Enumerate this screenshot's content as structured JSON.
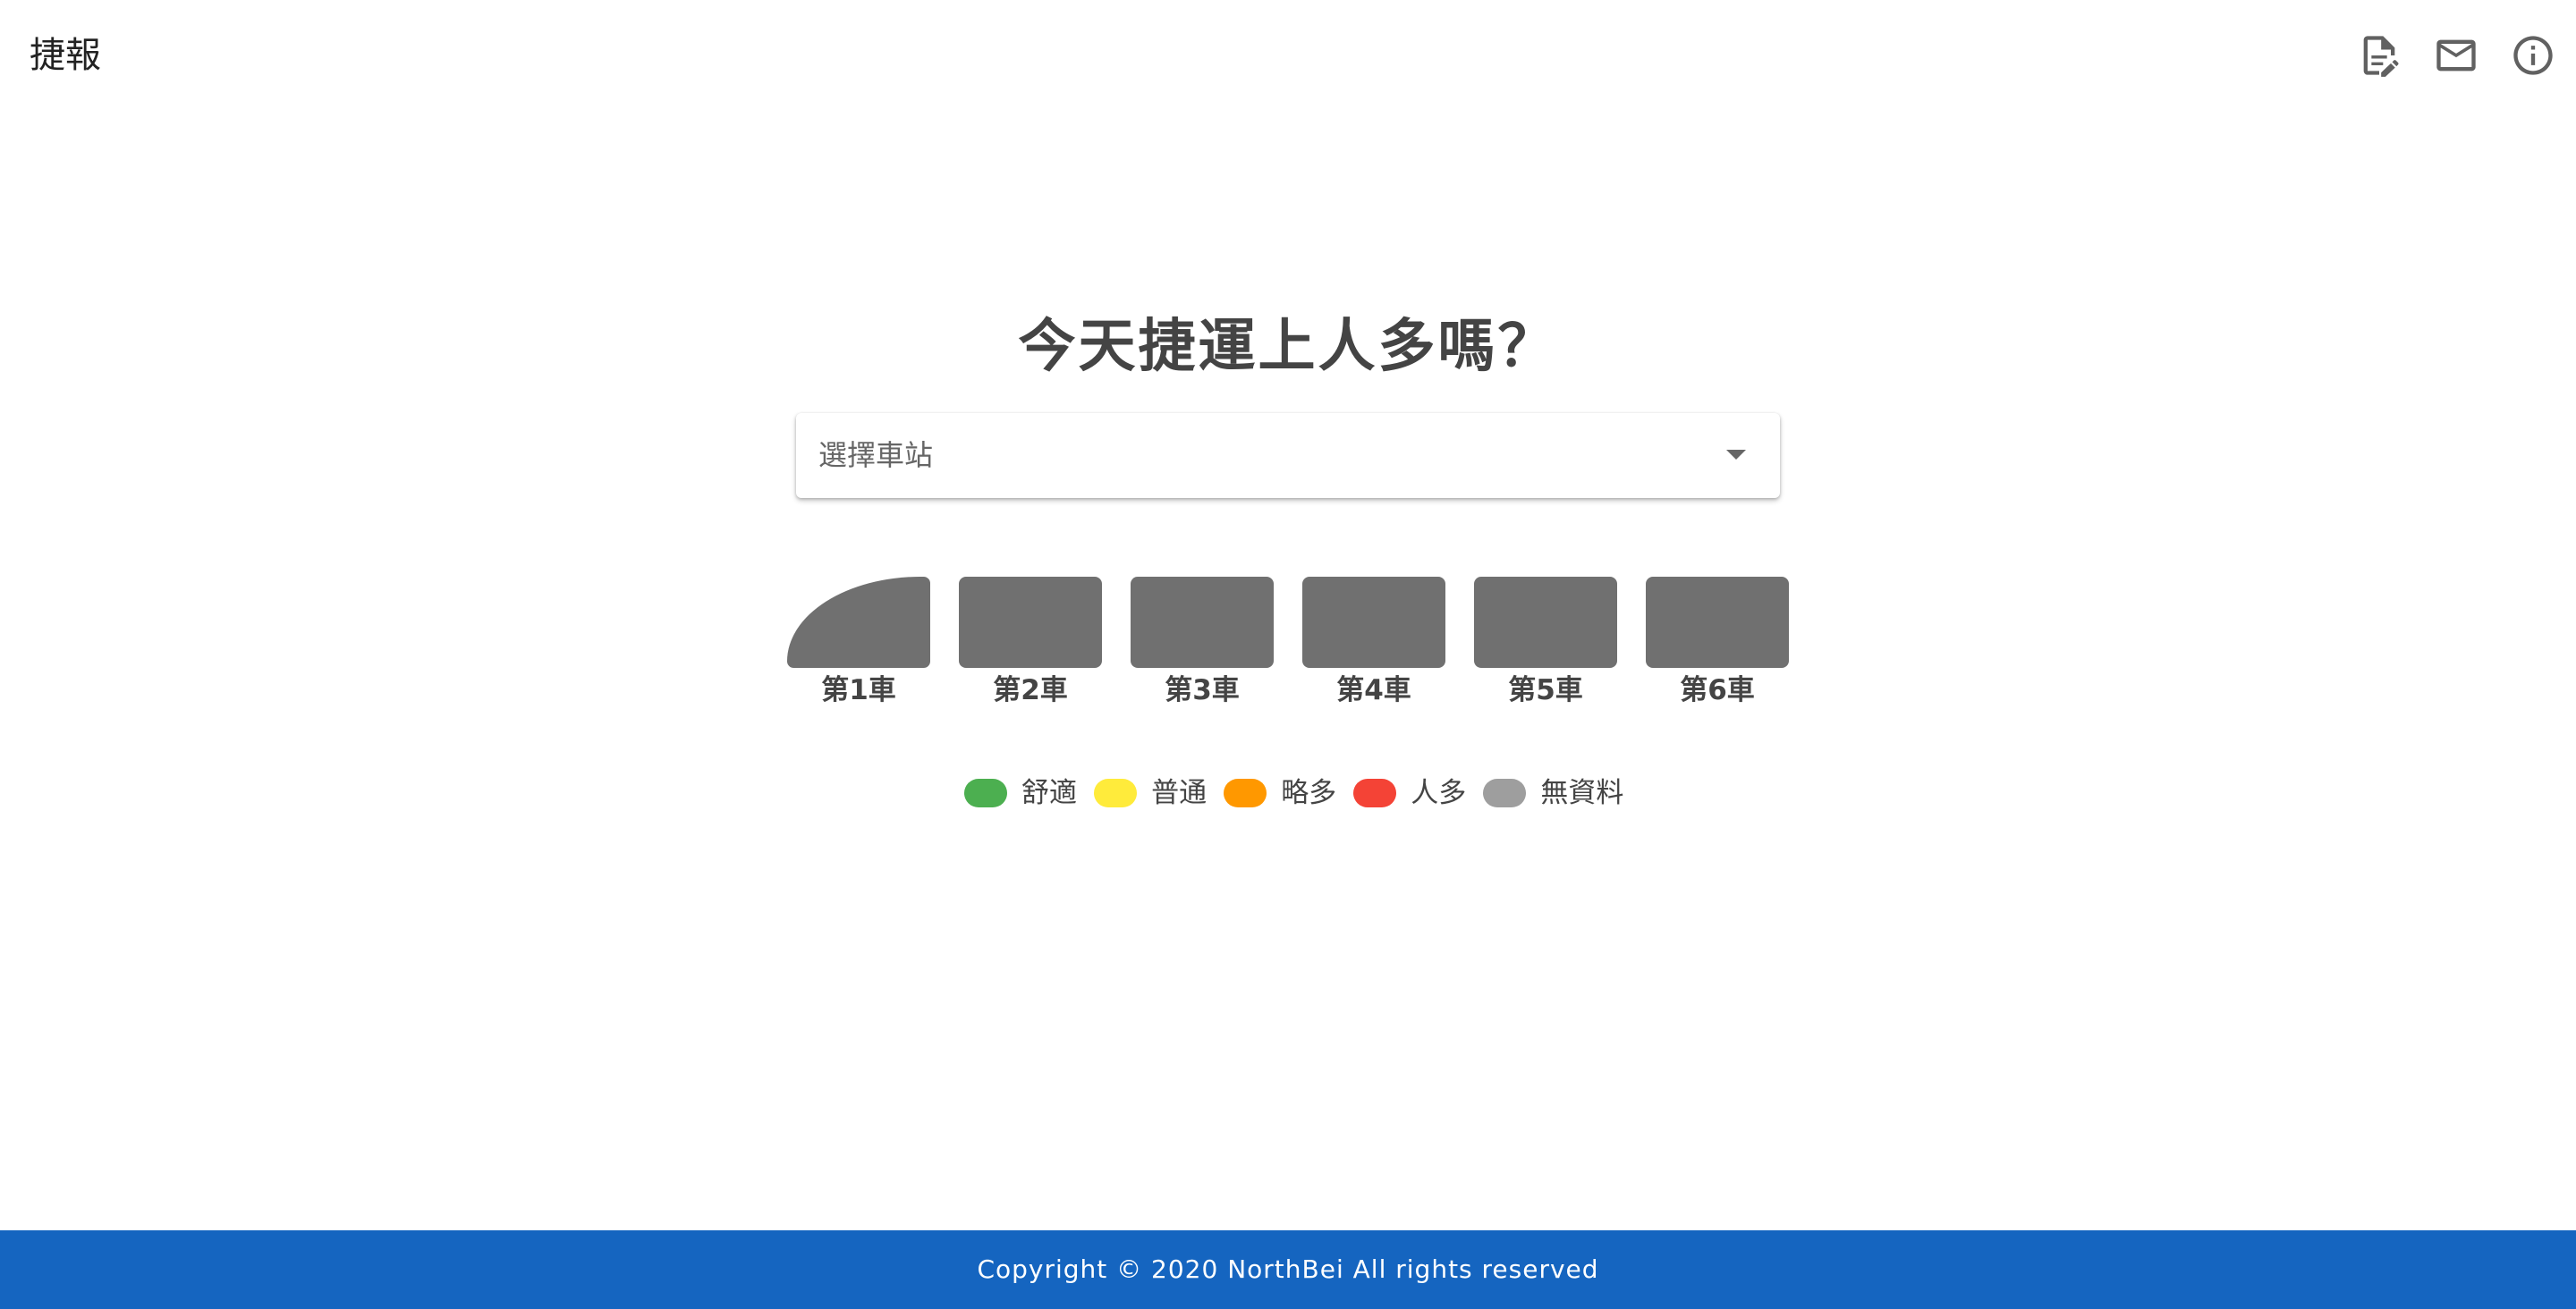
{
  "app": {
    "title": "捷報"
  },
  "toolbar": {
    "icons": [
      "edit-document-icon",
      "mail-icon",
      "info-icon"
    ],
    "icon_color": "#616161"
  },
  "main": {
    "heading": "今天捷運上人多嗎？",
    "station_select": {
      "placeholder": "選擇車站"
    },
    "cars": [
      {
        "label": "第1車"
      },
      {
        "label": "第2車"
      },
      {
        "label": "第3車"
      },
      {
        "label": "第4車"
      },
      {
        "label": "第5車"
      },
      {
        "label": "第6車"
      }
    ],
    "car_color": "#707070",
    "legend": [
      {
        "label": "舒適",
        "color": "#4caf50"
      },
      {
        "label": "普通",
        "color": "#ffeb3b"
      },
      {
        "label": "略多",
        "color": "#ff9800"
      },
      {
        "label": "人多",
        "color": "#f44336"
      },
      {
        "label": "無資料",
        "color": "#9e9e9e"
      }
    ]
  },
  "footer": {
    "text": "Copyright © 2020 NorthBei All rights reserved",
    "background": "#1565c0"
  }
}
